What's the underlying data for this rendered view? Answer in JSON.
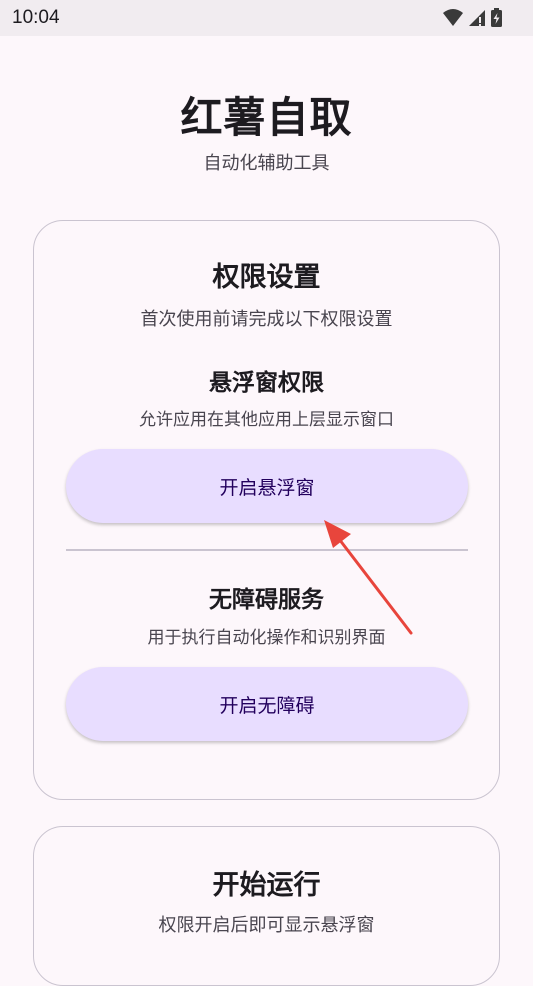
{
  "status_bar": {
    "time": "10:04",
    "icons": [
      "wifi-icon",
      "signal-icon",
      "battery-charging-icon"
    ]
  },
  "header": {
    "title": "红薯自取",
    "subtitle": "自动化辅助工具"
  },
  "permissions_card": {
    "title": "权限设置",
    "description": "首次使用前请完成以下权限设置",
    "overlay": {
      "title": "悬浮窗权限",
      "description": "允许应用在其他应用上层显示窗口",
      "button_label": "开启悬浮窗"
    },
    "accessibility": {
      "title": "无障碍服务",
      "description": "用于执行自动化操作和识别界面",
      "button_label": "开启无障碍"
    }
  },
  "run_card": {
    "title": "开始运行",
    "description": "权限开启后即可显示悬浮窗"
  },
  "colors": {
    "background": "#fdf7fb",
    "button": "#e8ddff",
    "button_text": "#22005d",
    "annotation_arrow": "#e8453c"
  }
}
